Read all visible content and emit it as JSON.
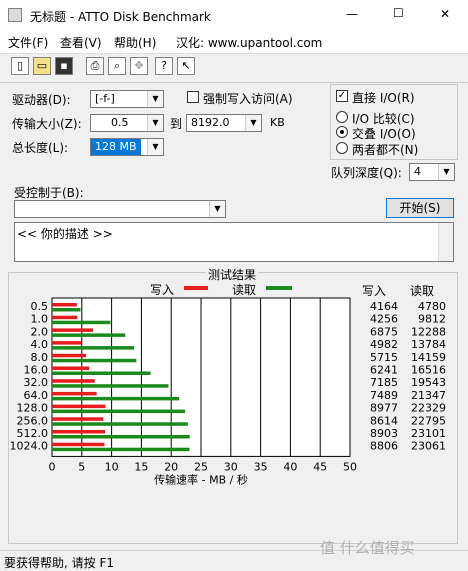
{
  "window": {
    "title": "无标题 - ATTO Disk Benchmark",
    "minimize": "—",
    "maximize": "☐",
    "close": "✕"
  },
  "menu": [
    "文件(F)",
    "查看(V)",
    "帮助(H)",
    "汉化: www.upantool.com"
  ],
  "toolbar": [
    "new-icon",
    "open-icon",
    "save-icon",
    "print-icon",
    "print-preview-icon",
    "move-icon",
    "help-icon",
    "context-help-icon"
  ],
  "settings": {
    "drive_label": "驱动器(D):",
    "drive_value": "[-f-]",
    "force_write_label": "强制写入访问(A)",
    "transfer_label": "传输大小(Z):",
    "transfer_from": "0.5",
    "to_label": "到",
    "transfer_to": "8192.0",
    "kb_label": "KB",
    "length_label": "总长度(L):",
    "length_value": "128 MB",
    "direct_io_label": "直接 I/O(R)",
    "io_compare_label": "I/O 比较(C)",
    "overlap_io_label": "交叠 I/O(O)",
    "neither_label": "两者都不(N)",
    "queue_label": "队列深度(Q):",
    "queue_value": "4",
    "controlled_label": "受控制于(B):",
    "start_button": "开始(S)",
    "description_text": "<<    你的描述    >>"
  },
  "results": {
    "group_title": "测试结果",
    "legend_write": "写入",
    "legend_read": "读取",
    "col_write": "写入",
    "col_read": "读取",
    "xlabel": "传输速率 - MB / 秒",
    "rows": [
      {
        "size": "0.5",
        "write": "4164",
        "read": "4780"
      },
      {
        "size": "1.0",
        "write": "4256",
        "read": "9812"
      },
      {
        "size": "2.0",
        "write": "6875",
        "read": "12288"
      },
      {
        "size": "4.0",
        "write": "4982",
        "read": "13784"
      },
      {
        "size": "8.0",
        "write": "5715",
        "read": "14159"
      },
      {
        "size": "16.0",
        "write": "6241",
        "read": "16516"
      },
      {
        "size": "32.0",
        "write": "7185",
        "read": "19543"
      },
      {
        "size": "64.0",
        "write": "7489",
        "read": "21347"
      },
      {
        "size": "128.0",
        "write": "8977",
        "read": "22329"
      },
      {
        "size": "256.0",
        "write": "8614",
        "read": "22795"
      },
      {
        "size": "512.0",
        "write": "8903",
        "read": "23101"
      },
      {
        "size": "1024.0",
        "write": "8806",
        "read": "23061"
      }
    ]
  },
  "colors": {
    "write": "#e81c1c",
    "read": "#1a8a1a"
  },
  "status": {
    "text": "要获得帮助, 请按 F1",
    "watermark": "值 什么值得买"
  },
  "chart_data": {
    "type": "bar",
    "orientation": "horizontal",
    "categories": [
      "0.5",
      "1.0",
      "2.0",
      "4.0",
      "8.0",
      "16.0",
      "32.0",
      "64.0",
      "128.0",
      "256.0",
      "512.0",
      "1024.0"
    ],
    "series": [
      {
        "name": "写入",
        "values": [
          4.164,
          4.256,
          6.875,
          4.982,
          5.715,
          6.241,
          7.185,
          7.489,
          8.977,
          8.614,
          8.903,
          8.806
        ]
      },
      {
        "name": "读取",
        "values": [
          4.78,
          9.812,
          12.288,
          13.784,
          14.159,
          16.516,
          19.543,
          21.347,
          22.329,
          22.795,
          23.101,
          23.061
        ]
      }
    ],
    "xlim": [
      0,
      50
    ],
    "xticks": [
      "0",
      "5",
      "10",
      "15",
      "20",
      "25",
      "30",
      "35",
      "40",
      "45",
      "50"
    ],
    "xlabel": "传输速率 - MB / 秒"
  }
}
